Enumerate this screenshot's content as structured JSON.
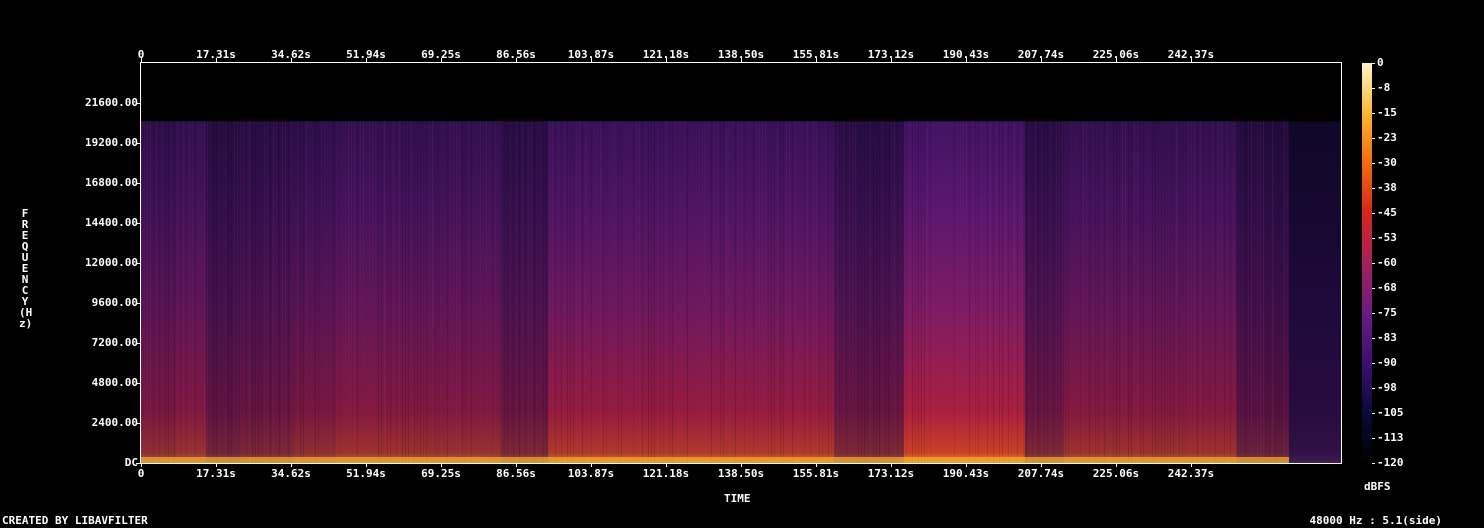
{
  "chart_data": {
    "type": "heatmap",
    "title": "",
    "xlabel": "TIME",
    "ylabel": "FREQUENCY (Hz)",
    "x_ticks": [
      "0",
      "17.31s",
      "34.62s",
      "51.94s",
      "69.25s",
      "86.56s",
      "103.87s",
      "121.18s",
      "138.50s",
      "155.81s",
      "173.12s",
      "190.43s",
      "207.74s",
      "225.06s",
      "242.37s"
    ],
    "x_tick_values_s": [
      0,
      17.31,
      34.62,
      51.94,
      69.25,
      86.56,
      103.87,
      121.18,
      138.5,
      155.81,
      173.12,
      190.43,
      207.74,
      225.06,
      242.37
    ],
    "x_range_s": [
      0,
      277
    ],
    "y_ticks": [
      "DC",
      "2400.00",
      "4800.00",
      "7200.00",
      "9600.00",
      "12000.00",
      "14400.00",
      "16800.00",
      "19200.00",
      "21600.00"
    ],
    "y_tick_values_hz": [
      0,
      2400,
      4800,
      7200,
      9600,
      12000,
      14400,
      16800,
      19200,
      21600
    ],
    "y_range_hz": [
      0,
      24000
    ],
    "content_cutoff_hz": 20500,
    "colorbar": {
      "unit": "dBFS",
      "ticks": [
        "0",
        "-8",
        "-15",
        "-23",
        "-30",
        "-38",
        "-45",
        "-53",
        "-60",
        "-68",
        "-75",
        "-83",
        "-90",
        "-98",
        "-105",
        "-113",
        "-120"
      ],
      "range": [
        -120,
        0
      ],
      "colors": [
        "#000000",
        "#0a0a38",
        "#3b0f70",
        "#6a1c81",
        "#a3205b",
        "#d6251c",
        "#f26b0f",
        "#fbb733",
        "#fff5c8"
      ]
    },
    "segments": [
      {
        "start_s": 0,
        "end_s": 8,
        "level": 0.55
      },
      {
        "start_s": 8,
        "end_s": 15,
        "level": 0.6
      },
      {
        "start_s": 15,
        "end_s": 23,
        "level": 0.4
      },
      {
        "start_s": 23,
        "end_s": 35,
        "level": 0.45
      },
      {
        "start_s": 35,
        "end_s": 45,
        "level": 0.55
      },
      {
        "start_s": 45,
        "end_s": 66,
        "level": 0.62
      },
      {
        "start_s": 66,
        "end_s": 83,
        "level": 0.6
      },
      {
        "start_s": 83,
        "end_s": 94,
        "level": 0.45
      },
      {
        "start_s": 94,
        "end_s": 160,
        "level": 0.72
      },
      {
        "start_s": 160,
        "end_s": 176,
        "level": 0.45
      },
      {
        "start_s": 176,
        "end_s": 204,
        "level": 0.85
      },
      {
        "start_s": 204,
        "end_s": 213,
        "level": 0.45
      },
      {
        "start_s": 213,
        "end_s": 253,
        "level": 0.62
      },
      {
        "start_s": 253,
        "end_s": 265,
        "level": 0.35
      },
      {
        "start_s": 265,
        "end_s": 277,
        "level": 0.1
      }
    ]
  },
  "footer": {
    "left": "CREATED BY LIBAVFILTER",
    "right": "48000 Hz : 5.1(side)"
  }
}
